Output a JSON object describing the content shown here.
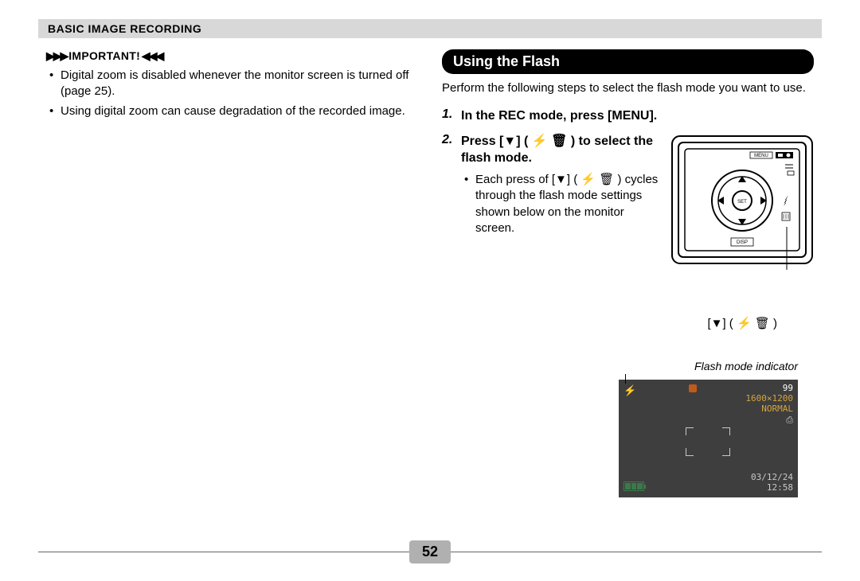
{
  "header": {
    "title": "BASIC IMAGE RECORDING"
  },
  "left": {
    "important_label": "IMPORTANT!",
    "bullets": [
      "Digital zoom is disabled whenever the monitor screen is turned off (page 25).",
      "Using digital zoom can cause degradation of the recorded image."
    ]
  },
  "right": {
    "section_title": "Using the Flash",
    "intro": "Perform the following steps to select the flash mode you want to use.",
    "step1": "In the REC mode, press [MENU].",
    "step2_prefix": "Press [",
    "step2_mid": "] ( ",
    "step2_suffix": " ) to select the flash mode.",
    "step2_sub": "Each press of [▼] ( ⚡ 🗑 ) cycles through the flash mode settings shown below on the monitor screen.",
    "callout_down": "[▼] ( ⚡ 🗑 )",
    "flash_caption": "Flash mode indicator",
    "camera_labels": {
      "menu": "MENU",
      "set": "SET",
      "disp": "DISP"
    }
  },
  "screen": {
    "shots": "99",
    "resolution": "1600×1200",
    "quality": "NORMAL",
    "date": "03/12/24",
    "time": "12:58"
  },
  "page_number": "52"
}
